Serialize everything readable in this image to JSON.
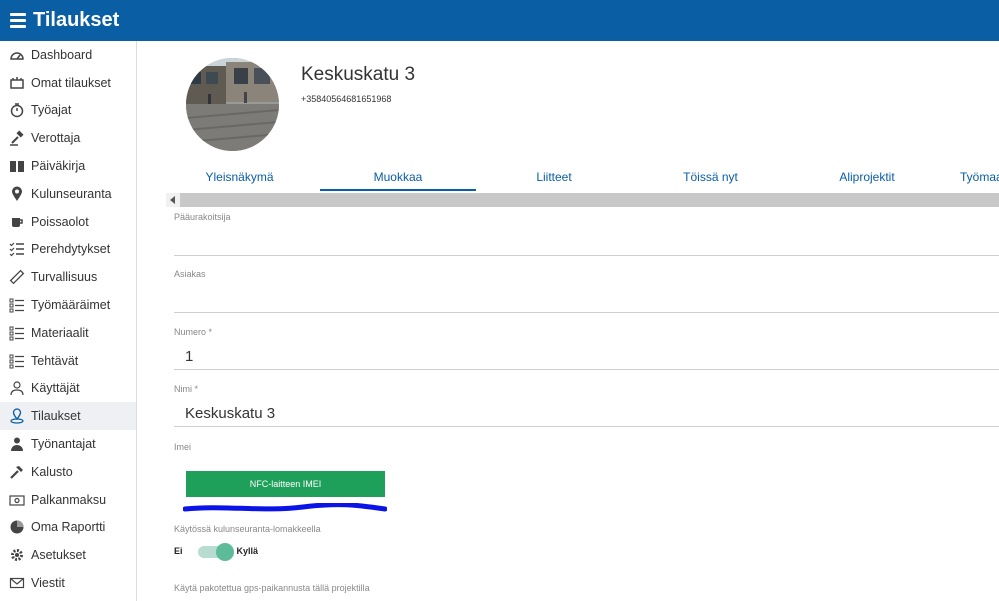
{
  "header": {
    "title": "Tilaukset"
  },
  "sidebar": {
    "items": [
      {
        "label": "Dashboard",
        "icon": "dashboard-gauge-icon"
      },
      {
        "label": "Omat tilaukset",
        "icon": "orders-icon"
      },
      {
        "label": "Työajat",
        "icon": "stopwatch-icon"
      },
      {
        "label": "Verottaja",
        "icon": "gavel-icon"
      },
      {
        "label": "Päiväkirja",
        "icon": "book-icon"
      },
      {
        "label": "Kulunseuranta",
        "icon": "map-pin-icon"
      },
      {
        "label": "Poissaolot",
        "icon": "coffee-cup-icon"
      },
      {
        "label": "Perehdytykset",
        "icon": "checklist-icon"
      },
      {
        "label": "Turvallisuus",
        "icon": "ruler-icon"
      },
      {
        "label": "Työmääräimet",
        "icon": "list-icon"
      },
      {
        "label": "Materiaalit",
        "icon": "list-icon"
      },
      {
        "label": "Tehtävät",
        "icon": "list-icon"
      },
      {
        "label": "Käyttäjät",
        "icon": "users-icon"
      },
      {
        "label": "Tilaukset",
        "icon": "location-user-icon",
        "active": true
      },
      {
        "label": "Työnantajat",
        "icon": "user-icon"
      },
      {
        "label": "Kalusto",
        "icon": "hammer-icon"
      },
      {
        "label": "Palkanmaksu",
        "icon": "money-icon"
      },
      {
        "label": "Oma Raportti",
        "icon": "pie-chart-icon"
      },
      {
        "label": "Asetukset",
        "icon": "gear-icon"
      },
      {
        "label": "Viestit",
        "icon": "envelope-icon"
      }
    ]
  },
  "project": {
    "title": "Keskuskatu 3",
    "phone": "+35840564681651968"
  },
  "tabs": [
    {
      "label": "Yleisnäkymä"
    },
    {
      "label": "Muokkaa",
      "active": true
    },
    {
      "label": "Liitteet"
    },
    {
      "label": "Töissä nyt"
    },
    {
      "label": "Aliprojektit"
    },
    {
      "label": "Työmaa"
    }
  ],
  "form": {
    "main_contractor_label": "Pääurakoitsija",
    "customer_label": "Asiakas",
    "number_label": "Numero *",
    "number_value": "1",
    "name_label": "Nimi *",
    "name_value": "Keskuskatu 3",
    "imei_label": "Imei",
    "nfc_button": "NFC-laitteen IMEI",
    "tracking_label": "Käytössä kulunseuranta-lomakkeella",
    "toggle_off": "Ei",
    "toggle_on": "Kyllä",
    "tracking_enabled": true,
    "gps_label": "Käytä pakotettua gps-paikannusta tällä projektilla"
  },
  "colors": {
    "header": "#0a5ea3",
    "accent": "#0a5ea3",
    "nfc_button": "#1fa05a",
    "toggle": "#5cbc9a"
  }
}
